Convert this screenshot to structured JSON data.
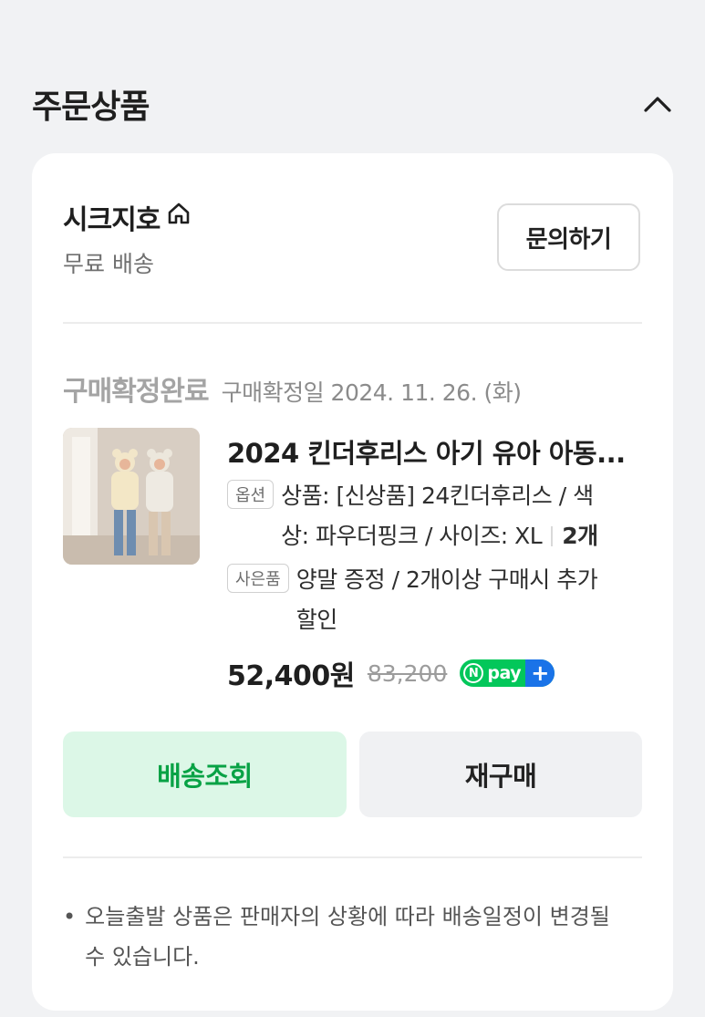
{
  "section": {
    "title": "주문상품",
    "collapse_icon": "chevron-up-icon"
  },
  "store": {
    "name": "시크지호",
    "home_icon": "home-icon",
    "shipping": "무료 배송",
    "inquiry_label": "문의하기"
  },
  "order": {
    "status": "구매확정완료",
    "confirm_date": "구매확정일 2024. 11. 26. (화)"
  },
  "product": {
    "title": "2024 킨더후리스 아기 유아 아동...",
    "option_badge": "옵션",
    "option_line1": "상품: [신상품] 24킨더후리스 / 색",
    "option_line2": "상: 파우더핑크 / 사이즈: XL",
    "quantity": "2개",
    "gift_badge": "사은품",
    "gift_line1": "양말 증정 / 2개이상 구매시 추가",
    "gift_line2": "할인",
    "price": "52,400원",
    "original_price": "83,200",
    "npay_label": "pay",
    "npay_n": "N",
    "npay_plus": "+"
  },
  "actions": {
    "track_label": "배송조회",
    "rebuy_label": "재구매"
  },
  "notice": {
    "bullet": "•",
    "line1": "오늘출발 상품은 판매자의 상황에 따라 배송일정이 변경될",
    "line2": "수 있습니다."
  },
  "colors": {
    "accent_green": "#03c75a",
    "track_text": "#08a245",
    "track_bg": "#dcf7e7",
    "npay_plus_blue": "#1a73e8"
  }
}
